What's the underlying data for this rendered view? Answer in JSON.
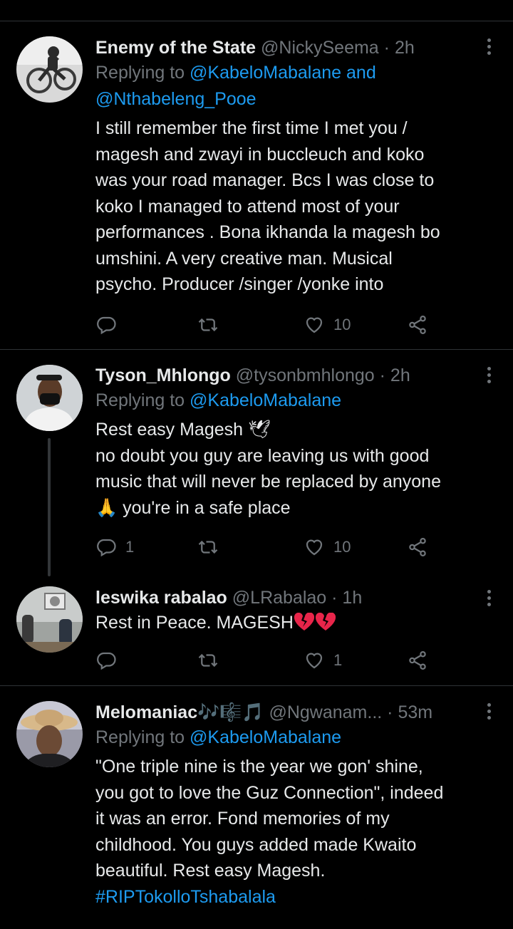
{
  "tweets": [
    {
      "name": "Enemy of the State",
      "handle": "@NickySeema",
      "time": "· 2h",
      "reply_prefix": "Replying to",
      "reply_mention_1": "@KabeloMabalane",
      "reply_and": "and",
      "reply_mention_2": "@Nthabeleng_Pooe",
      "lines": [
        "I still remember the first time I met you /",
        "magesh and zwayi in buccleuch and koko",
        "was your road manager. Bcs I was close to",
        "koko I managed to attend most of your",
        "performances . Bona ikhanda la magesh bo",
        "umshini. A very creative man. Musical",
        "psycho. Producer /singer /yonke into"
      ],
      "reply_count": "",
      "like_count": "10"
    },
    {
      "name": "Tyson_Mhlongo",
      "handle": "@tysonbmhlongo",
      "time": "· 2h",
      "reply_prefix": "Replying to",
      "reply_mention_1": "@KabeloMabalane",
      "line1": "Rest easy Magesh",
      "line2": "no doubt you guy are leaving us with good",
      "line3": "music that will never be replaced by anyone",
      "line4": "you're in a safe place",
      "reply_count": "1",
      "like_count": "10"
    },
    {
      "name": "leswika rabalao",
      "handle": "@LRabalao",
      "time": "· 1h",
      "text": "Rest in Peace. MAGESH",
      "reply_count": "",
      "like_count": "1"
    },
    {
      "name": "Melomaniac",
      "name_emoji": "🎶🎼🎵",
      "handle": "@Ngwanam...",
      "time": "· 53m",
      "reply_prefix": "Replying to",
      "reply_mention_1": "@KabeloMabalane",
      "lines": [
        "\"One triple nine is the year we gon' shine,",
        "you got to love the Guz Connection\", indeed",
        "it was an error. Fond memories of my",
        "childhood. You guys added made Kwaito",
        "beautiful. Rest easy Magesh."
      ],
      "hashtag": "#RIPTokolloTshabalala"
    }
  ],
  "icons": [
    "reply-icon",
    "retweet-icon",
    "like-icon",
    "share-icon",
    "more-icon",
    "dove-emoji",
    "praying-hands-emoji",
    "broken-heart-emoji"
  ],
  "colors": {
    "background": "#000000",
    "text": "#e7e9ea",
    "muted": "#71767b",
    "link": "#1d9bf0",
    "divider": "#2f3336"
  }
}
